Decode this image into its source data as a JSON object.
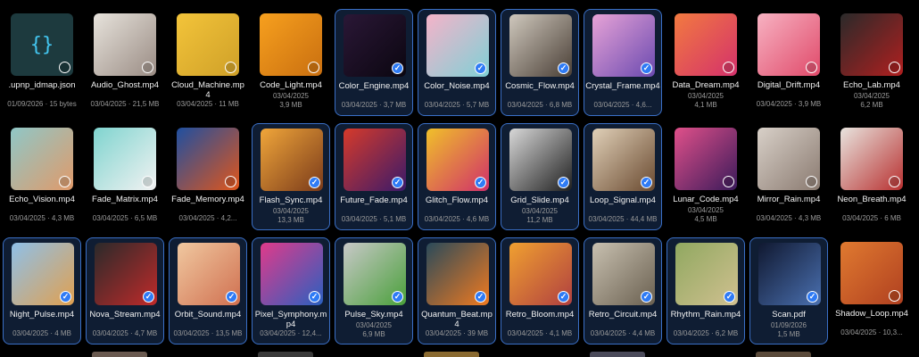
{
  "colors": {
    "accent": "#2f7bf5",
    "selected_bg": "#0f1d33",
    "selected_border": "#3a6fc6"
  },
  "files": [
    {
      "name": ".upnp_idmap.json",
      "date": "01/09/2026",
      "size": "15 bytes",
      "selected": false,
      "icon": "json-file-icon",
      "c1": "#1d3a3e",
      "c2": "#1d3a3e"
    },
    {
      "name": "Audio_Ghost.mp4",
      "date": "03/04/2025",
      "size": "21,5 MB",
      "selected": false,
      "icon": "video-thumbnail",
      "c1": "#e7e3dc",
      "c2": "#9a8c84"
    },
    {
      "name": "Cloud_Machine.mp4",
      "date": "03/04/2025",
      "size": "11 MB",
      "selected": false,
      "icon": "video-thumbnail",
      "c1": "#f3c43a",
      "c2": "#cfa028"
    },
    {
      "name": "Code_Light.mp4",
      "date": "03/04/2025",
      "size": "3,9 MB",
      "selected": false,
      "icon": "video-thumbnail",
      "c1": "#f7a01e",
      "c2": "#c96f10"
    },
    {
      "name": "Color_Engine.mp4",
      "date": "03/04/2025",
      "size": "3,7 MB",
      "selected": true,
      "icon": "video-thumbnail",
      "c1": "#2a1736",
      "c2": "#0b0610"
    },
    {
      "name": "Color_Noise.mp4",
      "date": "03/04/2025",
      "size": "5,7 MB",
      "selected": true,
      "icon": "video-thumbnail",
      "c1": "#f5b3c9",
      "c2": "#7fd0d6"
    },
    {
      "name": "Cosmic_Flow.mp4",
      "date": "03/04/2025",
      "size": "6,8 MB",
      "selected": true,
      "icon": "video-thumbnail",
      "c1": "#cfc8bd",
      "c2": "#4a3f36"
    },
    {
      "name": "Crystal_Frame.mp4",
      "date": "03/04/2025",
      "size": "4,6...",
      "selected": true,
      "icon": "video-thumbnail",
      "c1": "#e7a3d7",
      "c2": "#6b4ab0"
    },
    {
      "name": "Data_Dream.mp4",
      "date": "03/04/2025",
      "size": "4,1 MB",
      "selected": false,
      "icon": "video-thumbnail",
      "c1": "#f27a40",
      "c2": "#d4316b"
    },
    {
      "name": "Digital_Drift.mp4",
      "date": "03/04/2025",
      "size": "3,9 MB",
      "selected": false,
      "icon": "video-thumbnail",
      "c1": "#f7b2c2",
      "c2": "#e04a6a"
    },
    {
      "name": "Echo_Lab.mp4",
      "date": "03/04/2025",
      "size": "6,2 MB",
      "selected": false,
      "icon": "video-thumbnail",
      "c1": "#2a2a2a",
      "c2": "#b01f1f"
    },
    {
      "name": "Echo_Vision.mp4",
      "date": "03/04/2025",
      "size": "4,3 MB",
      "selected": false,
      "icon": "video-thumbnail",
      "c1": "#8fc7c7",
      "c2": "#e09a6a"
    },
    {
      "name": "Fade_Matrix.mp4",
      "date": "03/04/2025",
      "size": "6,5 MB",
      "selected": false,
      "icon": "video-thumbnail",
      "c1": "#7fd4cf",
      "c2": "#f2f2f2"
    },
    {
      "name": "Fade_Memory.mp4",
      "date": "03/04/2025",
      "size": "4,2...",
      "selected": false,
      "icon": "video-thumbnail",
      "c1": "#1f4fa0",
      "c2": "#e0561b"
    },
    {
      "name": "Flash_Sync.mp4",
      "date": "03/04/2025",
      "size": "13,3 MB",
      "selected": true,
      "icon": "video-thumbnail",
      "c1": "#f0a63a",
      "c2": "#7a3a1a"
    },
    {
      "name": "Future_Fade.mp4",
      "date": "03/04/2025",
      "size": "5,1 MB",
      "selected": true,
      "icon": "video-thumbnail",
      "c1": "#d63a2a",
      "c2": "#3a1a6a"
    },
    {
      "name": "Glitch_Flow.mp4",
      "date": "03/04/2025",
      "size": "4,6 MB",
      "selected": true,
      "icon": "video-thumbnail",
      "c1": "#f0c02a",
      "c2": "#d0306a"
    },
    {
      "name": "Grid_Slide.mp4",
      "date": "03/04/2025",
      "size": "11,2 MB",
      "selected": true,
      "icon": "video-thumbnail",
      "c1": "#d8d8d8",
      "c2": "#202020"
    },
    {
      "name": "Loop_Signal.mp4",
      "date": "03/04/2025",
      "size": "44,4 MB",
      "selected": true,
      "icon": "video-thumbnail",
      "c1": "#e0d0b8",
      "c2": "#6a4a30"
    },
    {
      "name": "Lunar_Code.mp4",
      "date": "03/04/2025",
      "size": "4,5 MB",
      "selected": false,
      "icon": "video-thumbnail",
      "c1": "#e0508a",
      "c2": "#3a1a5a"
    },
    {
      "name": "Mirror_Rain.mp4",
      "date": "03/04/2025",
      "size": "4,3 MB",
      "selected": false,
      "icon": "video-thumbnail",
      "c1": "#d8d0c8",
      "c2": "#8a7a70"
    },
    {
      "name": "Neon_Breath.mp4",
      "date": "03/04/2025",
      "size": "6 MB",
      "selected": false,
      "icon": "video-thumbnail",
      "c1": "#e8e4de",
      "c2": "#b83030"
    },
    {
      "name": "Night_Pulse.mp4",
      "date": "03/04/2025",
      "size": "4 MB",
      "selected": true,
      "icon": "video-thumbnail",
      "c1": "#8fc0e8",
      "c2": "#e0a050"
    },
    {
      "name": "Nova_Stream.mp4",
      "date": "03/04/2025",
      "size": "4,7 MB",
      "selected": true,
      "icon": "video-thumbnail",
      "c1": "#2a2a2a",
      "c2": "#c02a2a"
    },
    {
      "name": "Orbit_Sound.mp4",
      "date": "03/04/2025",
      "size": "13,5 MB",
      "selected": true,
      "icon": "video-thumbnail",
      "c1": "#f0c8a0",
      "c2": "#d07050"
    },
    {
      "name": "Pixel_Symphony.mp4",
      "date": "03/04/2025",
      "size": "12,4...",
      "selected": true,
      "icon": "video-thumbnail",
      "c1": "#e03a8a",
      "c2": "#2a60c0"
    },
    {
      "name": "Pulse_Sky.mp4",
      "date": "03/04/2025",
      "size": "6,9 MB",
      "selected": true,
      "icon": "video-thumbnail",
      "c1": "#c8c8c8",
      "c2": "#4aa03a"
    },
    {
      "name": "Quantum_Beat.mp4",
      "date": "03/04/2025",
      "size": "39 MB",
      "selected": true,
      "icon": "video-thumbnail",
      "c1": "#2a4a5a",
      "c2": "#f07a20"
    },
    {
      "name": "Retro_Bloom.mp4",
      "date": "03/04/2025",
      "size": "4,1 MB",
      "selected": true,
      "icon": "video-thumbnail",
      "c1": "#f0a030",
      "c2": "#b04040"
    },
    {
      "name": "Retro_Circuit.mp4",
      "date": "03/04/2025",
      "size": "4,4 MB",
      "selected": true,
      "icon": "video-thumbnail",
      "c1": "#c8c0b0",
      "c2": "#6a6050"
    },
    {
      "name": "Rhythm_Rain.mp4",
      "date": "03/04/2025",
      "size": "6,2 MB",
      "selected": true,
      "icon": "video-thumbnail",
      "c1": "#90a860",
      "c2": "#d0c090"
    },
    {
      "name": "Scan.pdf",
      "date": "01/09/2026",
      "size": "1,5 MB",
      "selected": true,
      "icon": "document-thumbnail",
      "c1": "#101830",
      "c2": "#4a70b0"
    },
    {
      "name": "Shadow_Loop.mp4",
      "date": "03/04/2025",
      "size": "10,3...",
      "selected": false,
      "icon": "video-thumbnail",
      "c1": "#e07a30",
      "c2": "#b04020"
    }
  ]
}
